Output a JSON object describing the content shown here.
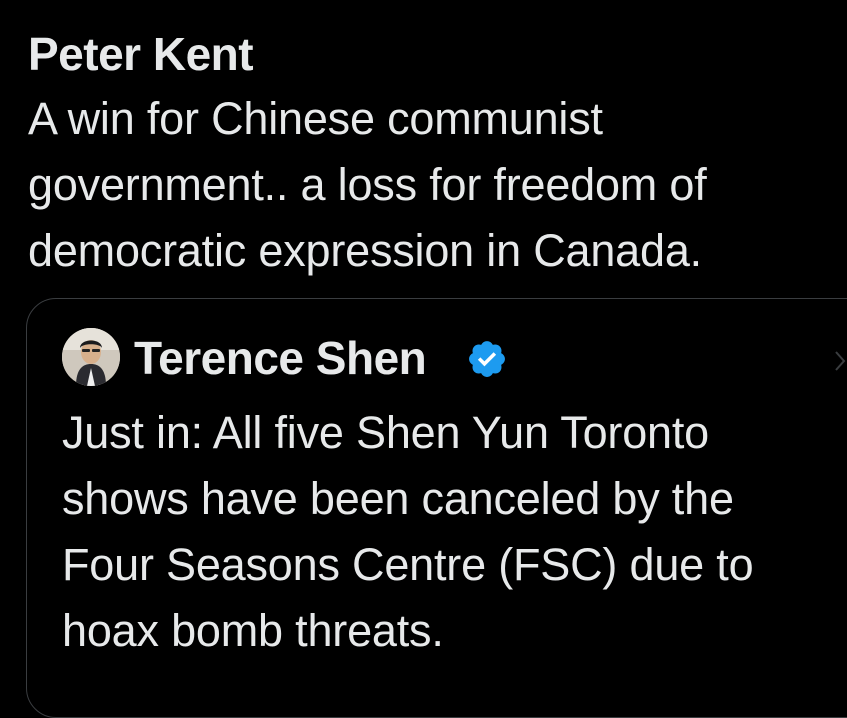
{
  "post": {
    "author_name": "Peter Kent",
    "author_handle_partial": "",
    "text": "A win for Chinese communist government.. a loss for freedom of democratic expression in Canada."
  },
  "quoted_post": {
    "author_name": "Terence Shen",
    "verified": true,
    "verified_icon": "verified-badge-icon",
    "avatar_icon": "avatar",
    "text": "Just in: All five Shen Yun Toronto shows have been canceled by the Four Seasons Centre (FSC) due to hoax bomb threats."
  },
  "colors": {
    "background": "#000000",
    "text": "#e7e9ea",
    "border": "#3a3d40",
    "verified_blue": "#1d9bf0"
  }
}
